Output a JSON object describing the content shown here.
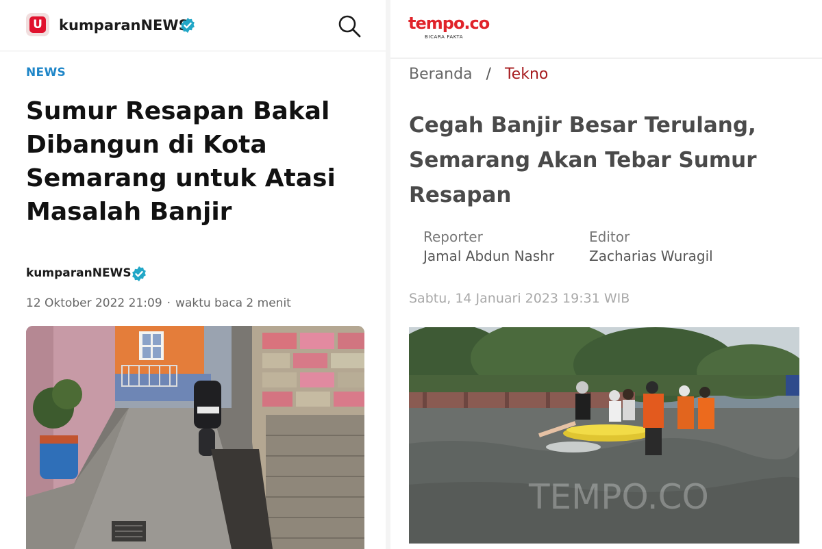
{
  "kumparan": {
    "logo_letter": "U",
    "brand": "kumparanNEWS",
    "section": "NEWS",
    "title": "Sumur Resapan Bakal Dibangun di Kota Semarang untuk Atasi Masalah Banjir",
    "author": "kumparanNEWS",
    "date": "12 Oktober 2022 21:09",
    "read_time": "waktu baca 2 menit",
    "icons": [
      "verified-badge-icon",
      "search-icon"
    ],
    "colors": {
      "brand_red": "#e0122e",
      "section_blue": "#1f86c8",
      "badge_teal": "#22a7c7"
    }
  },
  "tempo": {
    "logo": "tempo.co",
    "tagline": "BICARA FAKTA",
    "breadcrumb_home": "Beranda",
    "breadcrumb_separator": "/",
    "breadcrumb_current": "Tekno",
    "title": "Cegah Banjir Besar Terulang, Semarang Akan Tebar Sumur Resapan",
    "reporter_label": "Reporter",
    "reporter_name": "Jamal Abdun Nashr",
    "editor_label": "Editor",
    "editor_name": "Zacharias Wuragil",
    "date": "Sabtu, 14 Januari 2023 19:31 WIB",
    "photo_watermark": "TEMPO.CO",
    "colors": {
      "logo_red": "#e0232a",
      "crumb_red": "#a61b1e"
    }
  }
}
